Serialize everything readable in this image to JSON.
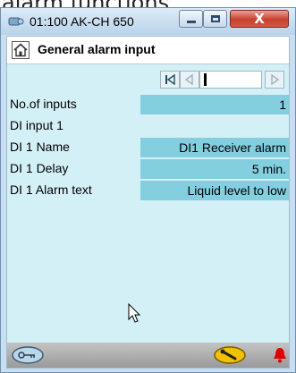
{
  "caption": {
    "partial_text": "alarm functions"
  },
  "window": {
    "title": "01:100 AK-CH 650",
    "close_glyph": "X",
    "icons": {
      "app": "controller-icon",
      "minimize": "minimize-icon",
      "maximize": "maximize-icon"
    }
  },
  "page": {
    "title": "General alarm input",
    "home_icon": "home-icon"
  },
  "navigator": {
    "icons": [
      "first-page-icon",
      "previous-page-icon",
      "next-page-icon"
    ],
    "current_value": ""
  },
  "fields": [
    {
      "label": "No.of inputs",
      "value": "1"
    },
    {
      "label": "DI input 1",
      "value": null
    },
    {
      "label": "DI 1 Name",
      "value": "DI1 Receiver alarm"
    },
    {
      "label": "DI 1 Delay",
      "value": "5 min."
    },
    {
      "label": "DI 1 Alarm text",
      "value": "Liquid level to low"
    }
  ],
  "bottom_bar": {
    "icons": [
      "login-key-icon",
      "service-wrench-icon",
      "alarm-bell-icon"
    ],
    "colors": {
      "wrench_button": "#f2c200",
      "bell": "#e00000"
    }
  },
  "colors": {
    "content_bg": "#d4f0f7",
    "value_field_bg": "#83cfe0",
    "header_bg": "#ffffff"
  }
}
